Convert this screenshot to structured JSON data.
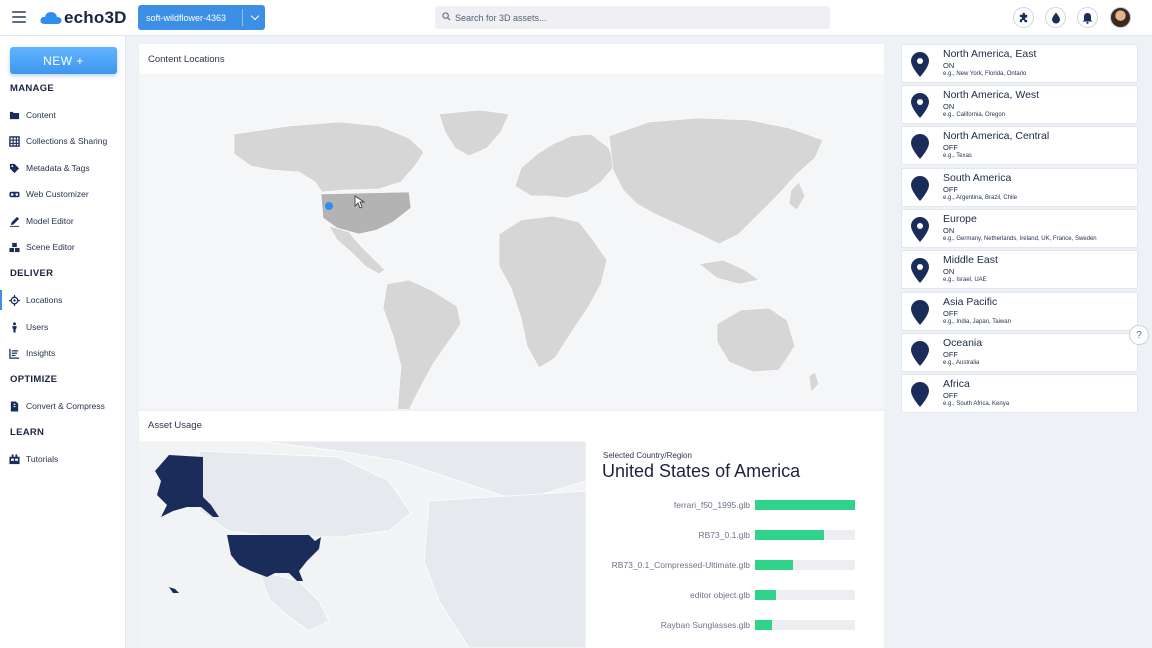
{
  "app": {
    "logo_text": "echo3D",
    "project": "soft-wildflower-4363",
    "search_placeholder": "Search for 3D assets..."
  },
  "topbar_icons": [
    "puzzle-icon",
    "drop-icon",
    "bell-icon",
    "avatar"
  ],
  "sidebar": {
    "new_label": "NEW +",
    "sections": [
      {
        "title": "MANAGE",
        "items": [
          "Content",
          "Collections & Sharing",
          "Metadata & Tags",
          "Web Customizer",
          "Model Editor",
          "Scene Editor"
        ]
      },
      {
        "title": "DELIVER",
        "items": [
          "Locations",
          "Users",
          "Insights"
        ]
      },
      {
        "title": "OPTIMIZE",
        "items": [
          "Convert & Compress"
        ]
      },
      {
        "title": "LEARN",
        "items": [
          "Tutorials"
        ]
      }
    ],
    "active_item": "Locations"
  },
  "content_locations": {
    "title": "Content Locations"
  },
  "asset_usage": {
    "title": "Asset Usage",
    "selected_label": "Selected Country/Region",
    "selected_country": "United States of America",
    "assets": [
      {
        "name": "ferrari_f50_1995.glb",
        "value": 1.0
      },
      {
        "name": "RB73_0.1.glb",
        "value": 0.69
      },
      {
        "name": "RB73_0.1_Compressed-Ultimate.glb",
        "value": 0.38
      },
      {
        "name": "editor object.glb",
        "value": 0.21
      },
      {
        "name": "Rayban Sunglasses.glb",
        "value": 0.17
      }
    ]
  },
  "regions": [
    {
      "name": "North America, East",
      "status": "ON",
      "examples": "e.g., New York, Florida, Ontario"
    },
    {
      "name": "North America, West",
      "status": "ON",
      "examples": "e.g., California, Oregon"
    },
    {
      "name": "North America, Central",
      "status": "OFF",
      "examples": "e.g., Texas"
    },
    {
      "name": "South America",
      "status": "OFF",
      "examples": "e.g., Argentina, Brazil, Chile"
    },
    {
      "name": "Europe",
      "status": "ON",
      "examples": "e.g., Germany, Netherlands, Ireland, UK, France, Sweden"
    },
    {
      "name": "Middle East",
      "status": "ON",
      "examples": "e.g., Israel, UAE"
    },
    {
      "name": "Asia Pacific",
      "status": "OFF",
      "examples": "e.g., India, Japan, Taiwan"
    },
    {
      "name": "Oceania",
      "status": "OFF",
      "examples": "e.g., Australia"
    },
    {
      "name": "Africa",
      "status": "OFF",
      "examples": "e.g., South Africa, Kenya"
    }
  ],
  "help_label": "?",
  "colors": {
    "accent": "#3d8fe6",
    "navy": "#1a2d5a",
    "bar": "#2fd389",
    "land": "#d6d6d6"
  }
}
